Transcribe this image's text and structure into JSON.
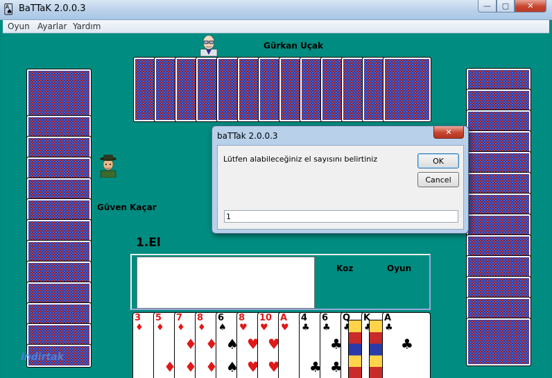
{
  "window": {
    "title": "BaTTaK  2.0.0.3",
    "app_icon": "batak-icon",
    "controls": {
      "minimize": "—",
      "maximize": "▢",
      "close": "✕"
    }
  },
  "menu": {
    "items": [
      "Oyun",
      "Ayarlar",
      "Yardım"
    ]
  },
  "players": {
    "top": {
      "name": "Gürkan Uçak",
      "avatar": "bald-glasses-avatar"
    },
    "left": {
      "name": "Güven Kaçar",
      "avatar": "hat-avatar"
    }
  },
  "round": {
    "label": "1.El"
  },
  "table": {
    "koz_label": "Koz",
    "oyun_label": "Oyun"
  },
  "hand": [
    {
      "rank": "3",
      "suit": "♦",
      "color": "red"
    },
    {
      "rank": "5",
      "suit": "♦",
      "color": "red"
    },
    {
      "rank": "7",
      "suit": "♦",
      "color": "red"
    },
    {
      "rank": "8",
      "suit": "♦",
      "color": "red"
    },
    {
      "rank": "6",
      "suit": "♠",
      "color": "black"
    },
    {
      "rank": "8",
      "suit": "♥",
      "color": "red"
    },
    {
      "rank": "10",
      "suit": "♥",
      "color": "red"
    },
    {
      "rank": "A",
      "suit": "♥",
      "color": "red"
    },
    {
      "rank": "4",
      "suit": "♣",
      "color": "black"
    },
    {
      "rank": "6",
      "suit": "♣",
      "color": "black"
    },
    {
      "rank": "Q",
      "suit": "♣",
      "color": "black"
    },
    {
      "rank": "K",
      "suit": "♣",
      "color": "black"
    },
    {
      "rank": "A",
      "suit": "♣",
      "color": "black"
    }
  ],
  "dialog": {
    "title": "baTTak 2.0.0.3",
    "message": "Lütfen alabileceğiniz el sayısını belirtiniz",
    "ok_label": "OK",
    "cancel_label": "Cancel",
    "input_value": "1",
    "close_glyph": "✕"
  },
  "watermark": "indirtak"
}
